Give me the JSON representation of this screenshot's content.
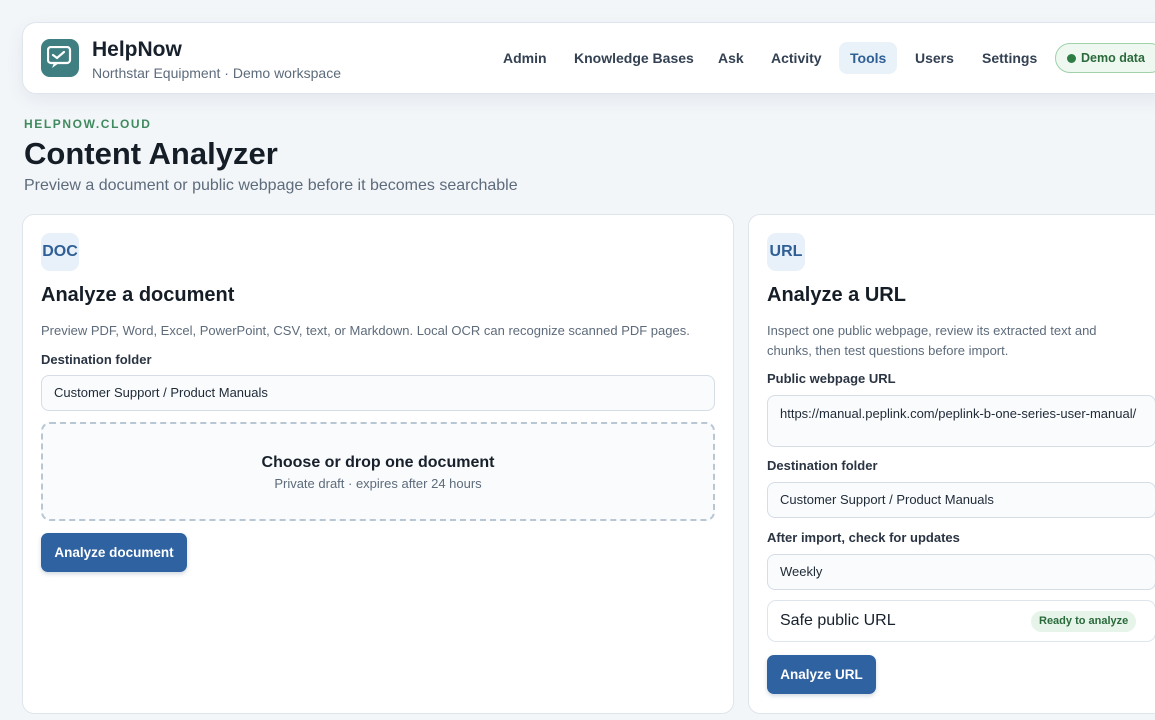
{
  "app": {
    "name": "HelpNow",
    "workspace": "Northstar Equipment · Demo workspace"
  },
  "nav": {
    "items": [
      {
        "label": "Admin"
      },
      {
        "label": "Knowledge Bases"
      },
      {
        "label": "Ask"
      },
      {
        "label": "Activity"
      },
      {
        "label": "Tools",
        "active": true
      },
      {
        "label": "Users"
      },
      {
        "label": "Settings"
      }
    ],
    "demo_label": "Demo data"
  },
  "header": {
    "eyebrow": "HELPNOW.CLOUD",
    "title": "Content Analyzer",
    "subtitle": "Preview a document or public webpage before it becomes searchable"
  },
  "doc_card": {
    "badge": "DOC",
    "title": "Analyze a document",
    "description": "Preview PDF, Word, Excel, PowerPoint, CSV, text, or Markdown. Local OCR can recognize scanned PDF pages.",
    "folder_label": "Destination folder",
    "folder_value": "Customer Support / Product Manuals",
    "drop_title": "Choose or drop one document",
    "drop_subtitle": "Private draft · expires after 24 hours",
    "button_label": "Analyze document"
  },
  "url_card": {
    "badge": "URL",
    "title": "Analyze a URL",
    "description": "Inspect one public webpage, review its extracted text and chunks, then test questions before import.",
    "url_label": "Public webpage URL",
    "url_value": "https://manual.peplink.com/peplink-b-one-series-user-manual/",
    "folder_label": "Destination folder",
    "folder_value": "Customer Support / Product Manuals",
    "schedule_label": "After import, check for updates",
    "schedule_value": "Weekly",
    "safe_label": "Safe public URL",
    "safe_status": "Ready to analyze",
    "button_label": "Analyze URL"
  },
  "colors": {
    "accent": "#2f62a0",
    "brand": "#3f7f82",
    "success": "#2e7d45"
  }
}
